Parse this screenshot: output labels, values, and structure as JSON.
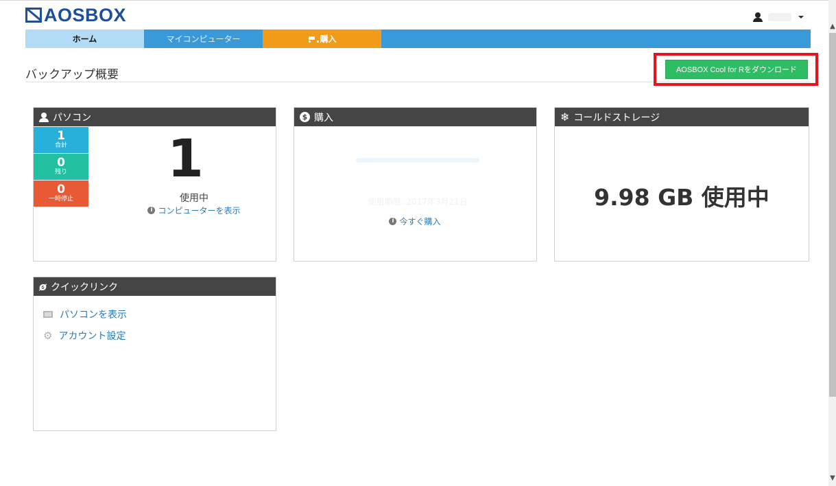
{
  "header": {
    "logo_text": "AOSBOX"
  },
  "nav": {
    "tabs": [
      {
        "label": "ホーム"
      },
      {
        "label": "マイコンピューター"
      },
      {
        "label": "購入"
      }
    ]
  },
  "page": {
    "title": "バックアップ概要",
    "download_button": "AOSBOX Cool for Rをダウンロード"
  },
  "pc_panel": {
    "title": "パソコン",
    "stats": [
      {
        "value": "1",
        "label": "合計",
        "color": "#27b0d9"
      },
      {
        "value": "0",
        "label": "残り",
        "color": "#22bfa0"
      },
      {
        "value": "0",
        "label": "一時停止",
        "color": "#e85a35"
      }
    ],
    "big_count": "1",
    "status": "使用中",
    "link": "コンピューターを表示"
  },
  "buy_panel": {
    "title": "購入",
    "faded_text": "使用期限: 2017年3月21日",
    "link": "今すぐ購入"
  },
  "cold_panel": {
    "title": "コールドストレージ",
    "usage": "9.98 GB 使用中"
  },
  "quick_panel": {
    "title": "クイックリンク",
    "items": [
      {
        "label": "パソコンを表示",
        "icon": "monitor-icon"
      },
      {
        "label": "アカウント設定",
        "icon": "gear-icon"
      }
    ]
  },
  "colors": {
    "brand": "#1f4e9a",
    "nav": "#3a9ad9",
    "purchase_tab": "#f29a1a",
    "download": "#2ebd63",
    "highlight": "#e8131b"
  }
}
